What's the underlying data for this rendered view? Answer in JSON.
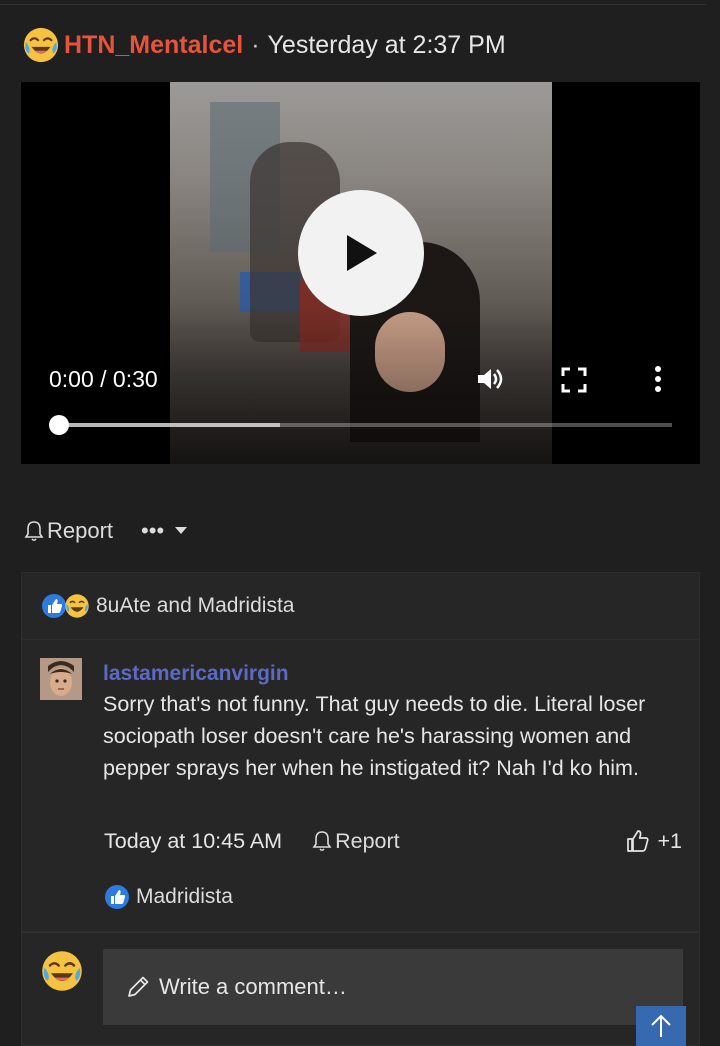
{
  "post": {
    "username": "HTN_Mentalcel",
    "separator": "·",
    "timestamp": "Yesterday at 2:37 PM",
    "avatar_icon": "crying-laughing-emoji-icon"
  },
  "video": {
    "time_display": "0:00 / 0:30",
    "progress": 0,
    "buffered_fraction": 0.36
  },
  "actions": {
    "report_label": "Report",
    "more_label": "•••"
  },
  "reactions": {
    "icons": [
      "like-icon",
      "crying-laughing-emoji-icon"
    ],
    "text": "8uAte and Madridista"
  },
  "comment": {
    "author": "lastamericanvirgin",
    "text": "Sorry that's not funny. That guy needs to die. Literal loser sociopath loser doesn't care he's harassing women and pepper sprays her when he instigated it? Nah I'd ko him.",
    "timestamp": "Today at 10:45 AM",
    "report_label": "Report",
    "like_count": "+1",
    "reactors": "Madridista"
  },
  "compose": {
    "placeholder": "Write a comment…"
  },
  "colors": {
    "background": "#1f1f1f",
    "username": "#e8533c",
    "comment_author": "#5c6ac4",
    "scroll_top_button": "#3769b0"
  }
}
